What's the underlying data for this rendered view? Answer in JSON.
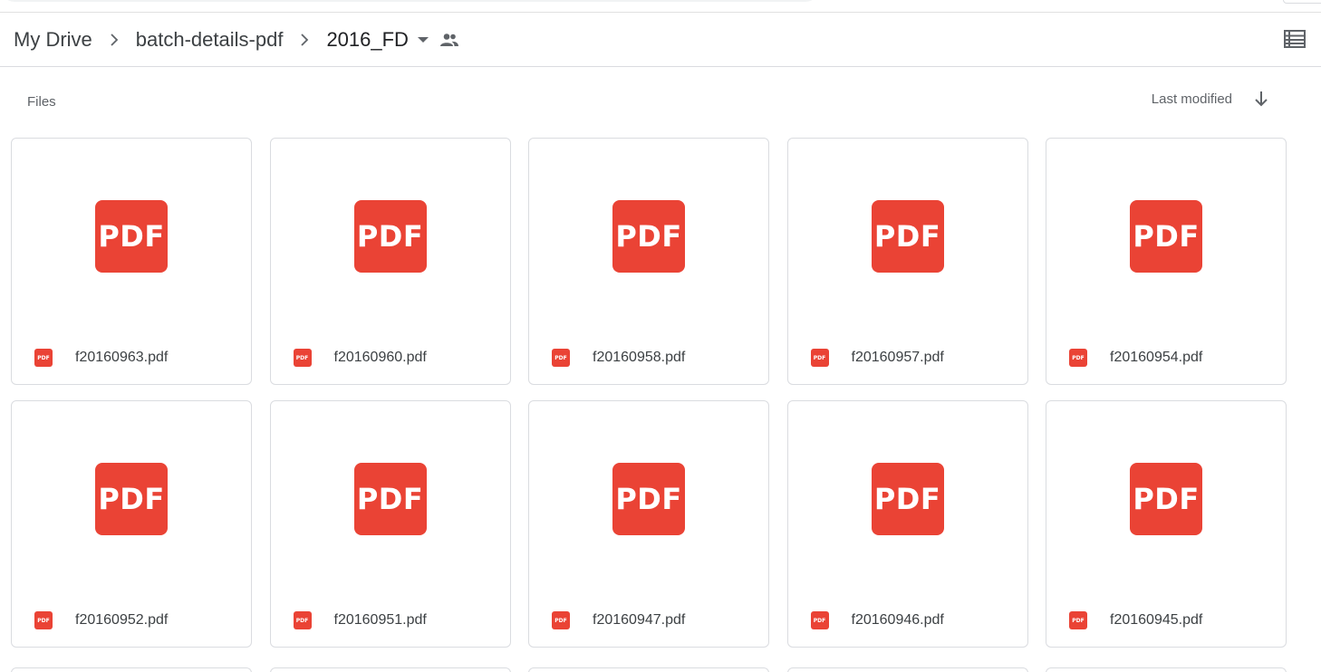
{
  "breadcrumb": {
    "items": [
      "My Drive",
      "batch-details-pdf"
    ],
    "current": "2016_FD"
  },
  "files_section": {
    "label": "Files",
    "sort_label": "Last modified"
  },
  "pdf_icon_text": "PDF",
  "pdf_small_icon_text": "PDF",
  "colors": {
    "pdf_red": "#ea4335",
    "border": "#dadce0",
    "icon_gray": "#5f6368"
  },
  "files": [
    {
      "name": "f20160963.pdf"
    },
    {
      "name": "f20160960.pdf"
    },
    {
      "name": "f20160958.pdf"
    },
    {
      "name": "f20160957.pdf"
    },
    {
      "name": "f20160954.pdf"
    },
    {
      "name": "f20160952.pdf"
    },
    {
      "name": "f20160951.pdf"
    },
    {
      "name": "f20160947.pdf"
    },
    {
      "name": "f20160946.pdf"
    },
    {
      "name": "f20160945.pdf"
    }
  ]
}
